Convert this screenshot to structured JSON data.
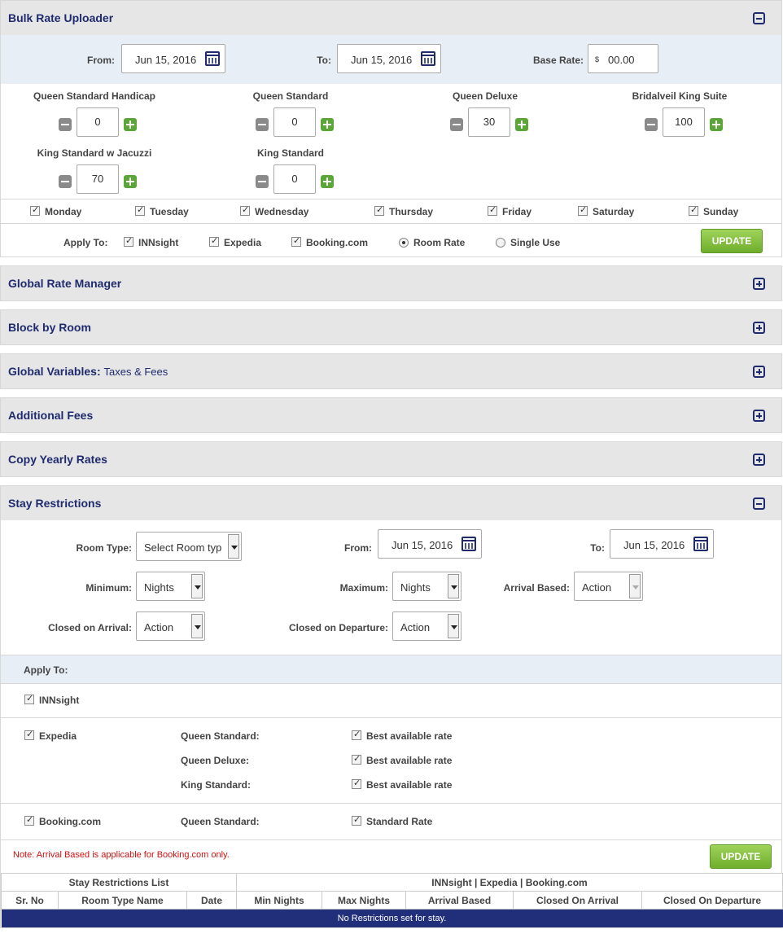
{
  "bulk": {
    "title": "Bulk Rate Uploader",
    "from_label": "From:",
    "from_value": "Jun 15, 2016",
    "to_label": "To:",
    "to_value": "Jun 15, 2016",
    "base_label": "Base Rate:",
    "base_currency": "$",
    "base_value": "00.00",
    "rooms": [
      {
        "name": "Queen Standard Handicap",
        "value": "0"
      },
      {
        "name": "Queen Standard",
        "value": "0"
      },
      {
        "name": "Queen Deluxe",
        "value": "30"
      },
      {
        "name": "Bridalveil King Suite",
        "value": "100"
      },
      {
        "name": "King Standard w Jacuzzi",
        "value": "70"
      },
      {
        "name": "King Standard",
        "value": "0"
      }
    ],
    "days": [
      "Monday",
      "Tuesday",
      "Wednesday",
      "Thursday",
      "Friday",
      "Saturday",
      "Sunday"
    ],
    "apply_label": "Apply To:",
    "channels": [
      "INNsight",
      "Expedia",
      "Booking.com"
    ],
    "rate_options": [
      "Room Rate",
      "Single Use"
    ],
    "update_label": "UPDATE"
  },
  "collapsed": [
    {
      "title": "Global Rate Manager",
      "sub": ""
    },
    {
      "title": "Block by Room",
      "sub": ""
    },
    {
      "title": "Global Variables:",
      "sub": "Taxes & Fees"
    },
    {
      "title": "Additional Fees",
      "sub": ""
    },
    {
      "title": "Copy Yearly Rates",
      "sub": ""
    }
  ],
  "stay": {
    "title": "Stay Restrictions",
    "room_type_label": "Room Type:",
    "room_type_value": "Select Room typ",
    "from_label": "From:",
    "from_value": "Jun 15, 2016",
    "to_label": "To:",
    "to_value": "Jun 15, 2016",
    "min_label": "Minimum:",
    "min_value": "Nights",
    "max_label": "Maximum:",
    "max_value": "Nights",
    "arrival_label": "Arrival Based:",
    "arrival_value": "Action",
    "coa_label": "Closed on Arrival:",
    "coa_value": "Action",
    "cod_label": "Closed on Departure:",
    "cod_value": "Action",
    "apply_label": "Apply To:",
    "innsight": "INNsight",
    "expedia": "Expedia",
    "expedia_rows": [
      {
        "room": "Queen Standard:",
        "rate": "Best available rate"
      },
      {
        "room": "Queen Deluxe:",
        "rate": "Best available rate"
      },
      {
        "room": "King Standard:",
        "rate": "Best available rate"
      }
    ],
    "booking": "Booking.com",
    "booking_rows": [
      {
        "room": "Queen Standard:",
        "rate": "Standard Rate"
      }
    ],
    "note": "Note: Arrival Based is applicable for Booking.com only.",
    "update_label": "UPDATE",
    "list_title": "Stay Restrictions List",
    "channels_title": "INNsight | Expedia | Booking.com",
    "columns": [
      "Sr. No",
      "Room Type Name",
      "Date",
      "Min Nights",
      "Max Nights",
      "Arrival Based",
      "Closed On Arrival",
      "Closed On Departure"
    ],
    "empty_text": "No Restrictions set for stay."
  }
}
